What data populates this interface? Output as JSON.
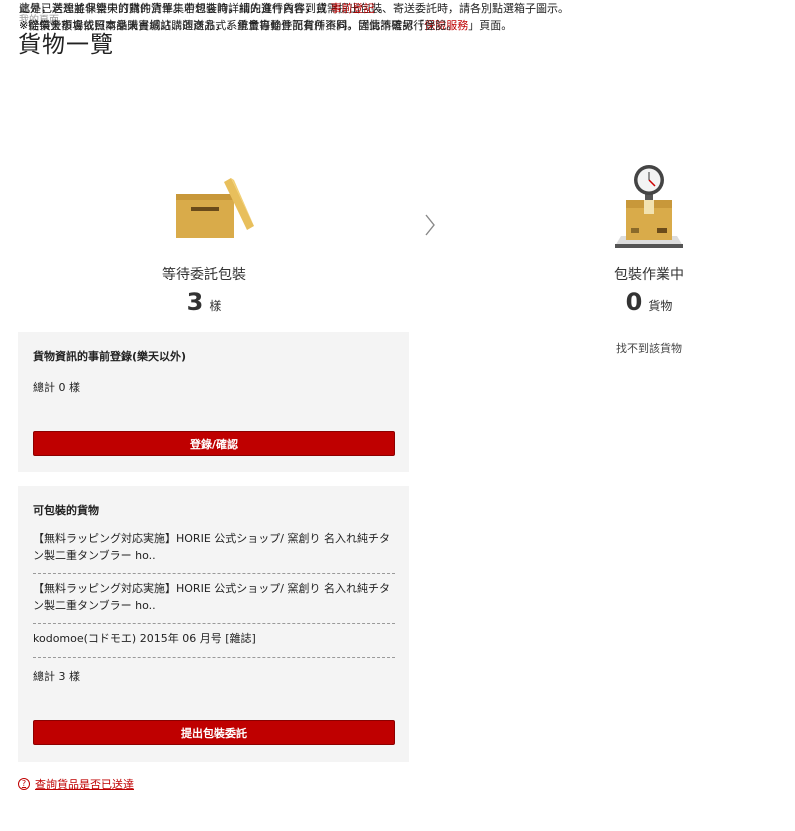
{
  "breadcrumb": "我的頁面",
  "page_title": "貨物一覽",
  "intro": {
    "line1": "這是已送達並保管中的貨件清單。若想查詢詳細的貨件內容，或需提出包裝、寄送委託時，請各別點選箱子圖示。",
    "line2_prefix": "※賠償金額會依照商品購買網站、運送方式、重量等條件而有所不同。詳情請確認「",
    "line2_link": "保險服務",
    "line2_suffix": "」頁面。",
    "line3_prefix": "此外，若想將非樂天訂購的貨件集中包裝時，請先進行貨件到貨",
    "line3_link": "事前登記",
    "line3_suffix": "。",
    "line4": "※從樂天市場或日本樂天書城訂購的商品，系統會自動登記貨件資料，因此不需另行登記。"
  },
  "status": {
    "waiting": {
      "label": "等待委託包裝",
      "count": "3",
      "unit": "樣",
      "icon": "open-box-icon"
    },
    "packing": {
      "label": "包裝作業中",
      "count": "0",
      "unit": "貨物",
      "note": "找不到該貨物",
      "icon": "package-scale-icon"
    }
  },
  "preregister_panel": {
    "title": "貨物資訊的事前登錄(樂天以外)",
    "total": "總計 0 樣",
    "button": "登錄/確認"
  },
  "packable_panel": {
    "title": "可包裝的貨物",
    "items": [
      "【無料ラッピング対応実施】HORIE 公式ショップ/ 窯創り 名入れ純チタン製二重タンブラー ho..",
      "【無料ラッピング対応実施】HORIE 公式ショップ/ 窯創り 名入れ純チタン製二重タンブラー ho..",
      "kodomoe(コドモエ) 2015年 06 月号 [雜誌]"
    ],
    "total": "總計 3 樣",
    "button": "提出包裝委託"
  },
  "help_link": "查詢貨品是否已送達",
  "colors": {
    "accent": "#bf0000",
    "panel_bg": "#f4f4f4",
    "box": "#d9ab4a"
  }
}
